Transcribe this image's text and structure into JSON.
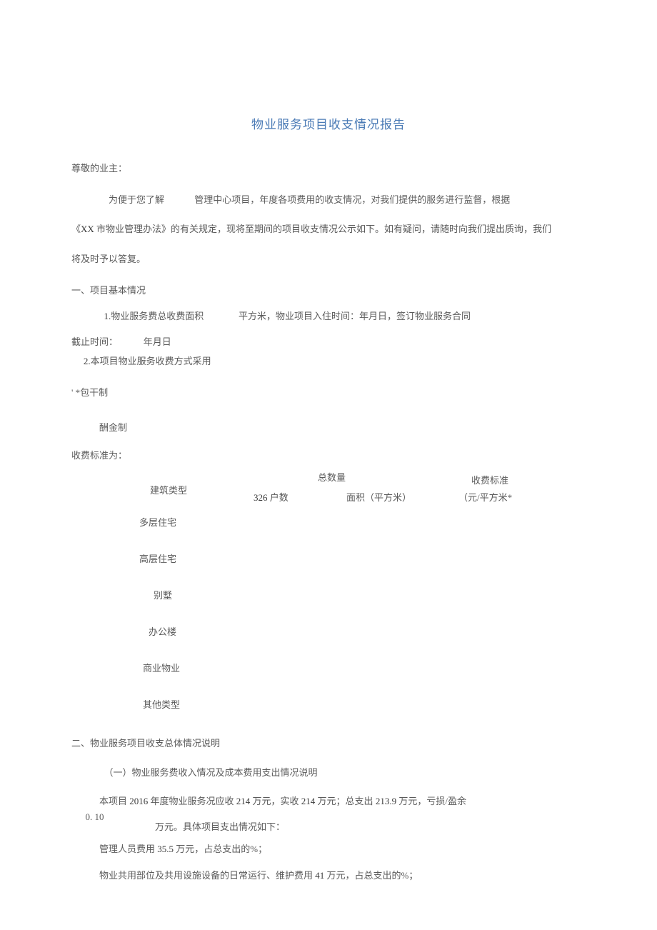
{
  "title": "物业服务项目收支情况报告",
  "salutation": "尊敬的业主：",
  "intro_part1": "为便于您了解",
  "intro_part2": "管理中心项目，年度各项费用的收支情况，",
  "intro_part3": "对我们提供的服务进行监督，根据",
  "intro_line2_a": "《",
  "intro_line2_b": "XX",
  "intro_line2_c": " 市物业管理办法》的有关规定，现将至期间的项目收支情况公示如下。如有疑问，请随时向我们提出质询，",
  "intro_line2_d": "我们",
  "intro_line3": "将及时予以答复。",
  "section1": "一、项目基本情况",
  "item1_a": "1.",
  "item1_b": "物业服务费总收费面积",
  "item1_c": "平方米，物业项目入住时间：年月日，签订物业服务合同",
  "deadline": "截止时间：",
  "deadline_date": "年月日",
  "item2_a": "2.",
  "item2_b": "本项目物业服务收费方式采用",
  "contract": "' *包干制",
  "reward": "酬金制",
  "fee_standard_label": "收费标准为：",
  "table": {
    "building_type": "建筑类型",
    "total_qty": "总数量",
    "households_num": "326",
    "households_label": " 户数",
    "area_label": "面积（平方米）",
    "fee_standard": "收费标准",
    "unit": "（元/平方米*",
    "rows": [
      "多层住宅",
      "高层住宅",
      "别墅",
      "办公楼",
      "商业物业",
      "其他类型"
    ]
  },
  "section2": "二、物业服务项目收支总体情况说明",
  "sub1": "（一）物业服务费收入情况及成本费用支出情况说明",
  "summary_a": "本项目 ",
  "summary_year": "2016",
  "summary_b": " 年度物业服务况应收 ",
  "summary_v1": "214",
  "summary_c": " 万元，实收 ",
  "summary_v2": "214",
  "summary_d": " 万元；总支出 ",
  "summary_v3": "213.9",
  "summary_e": " 万元，",
  "summary_f": "亏损/盈余",
  "balance_value": "0. 10",
  "balance_desc": "万元。具体项目支出情况如下：",
  "expense1_a": "管理人员费用 ",
  "expense1_v": "35.5",
  "expense1_b": " 万元，占总支出的%；",
  "expense2_a": "物业共用部位及共用设施设备的日常运行、维护费用 ",
  "expense2_v": "41",
  "expense2_b": " 万元，占总支出的%；"
}
